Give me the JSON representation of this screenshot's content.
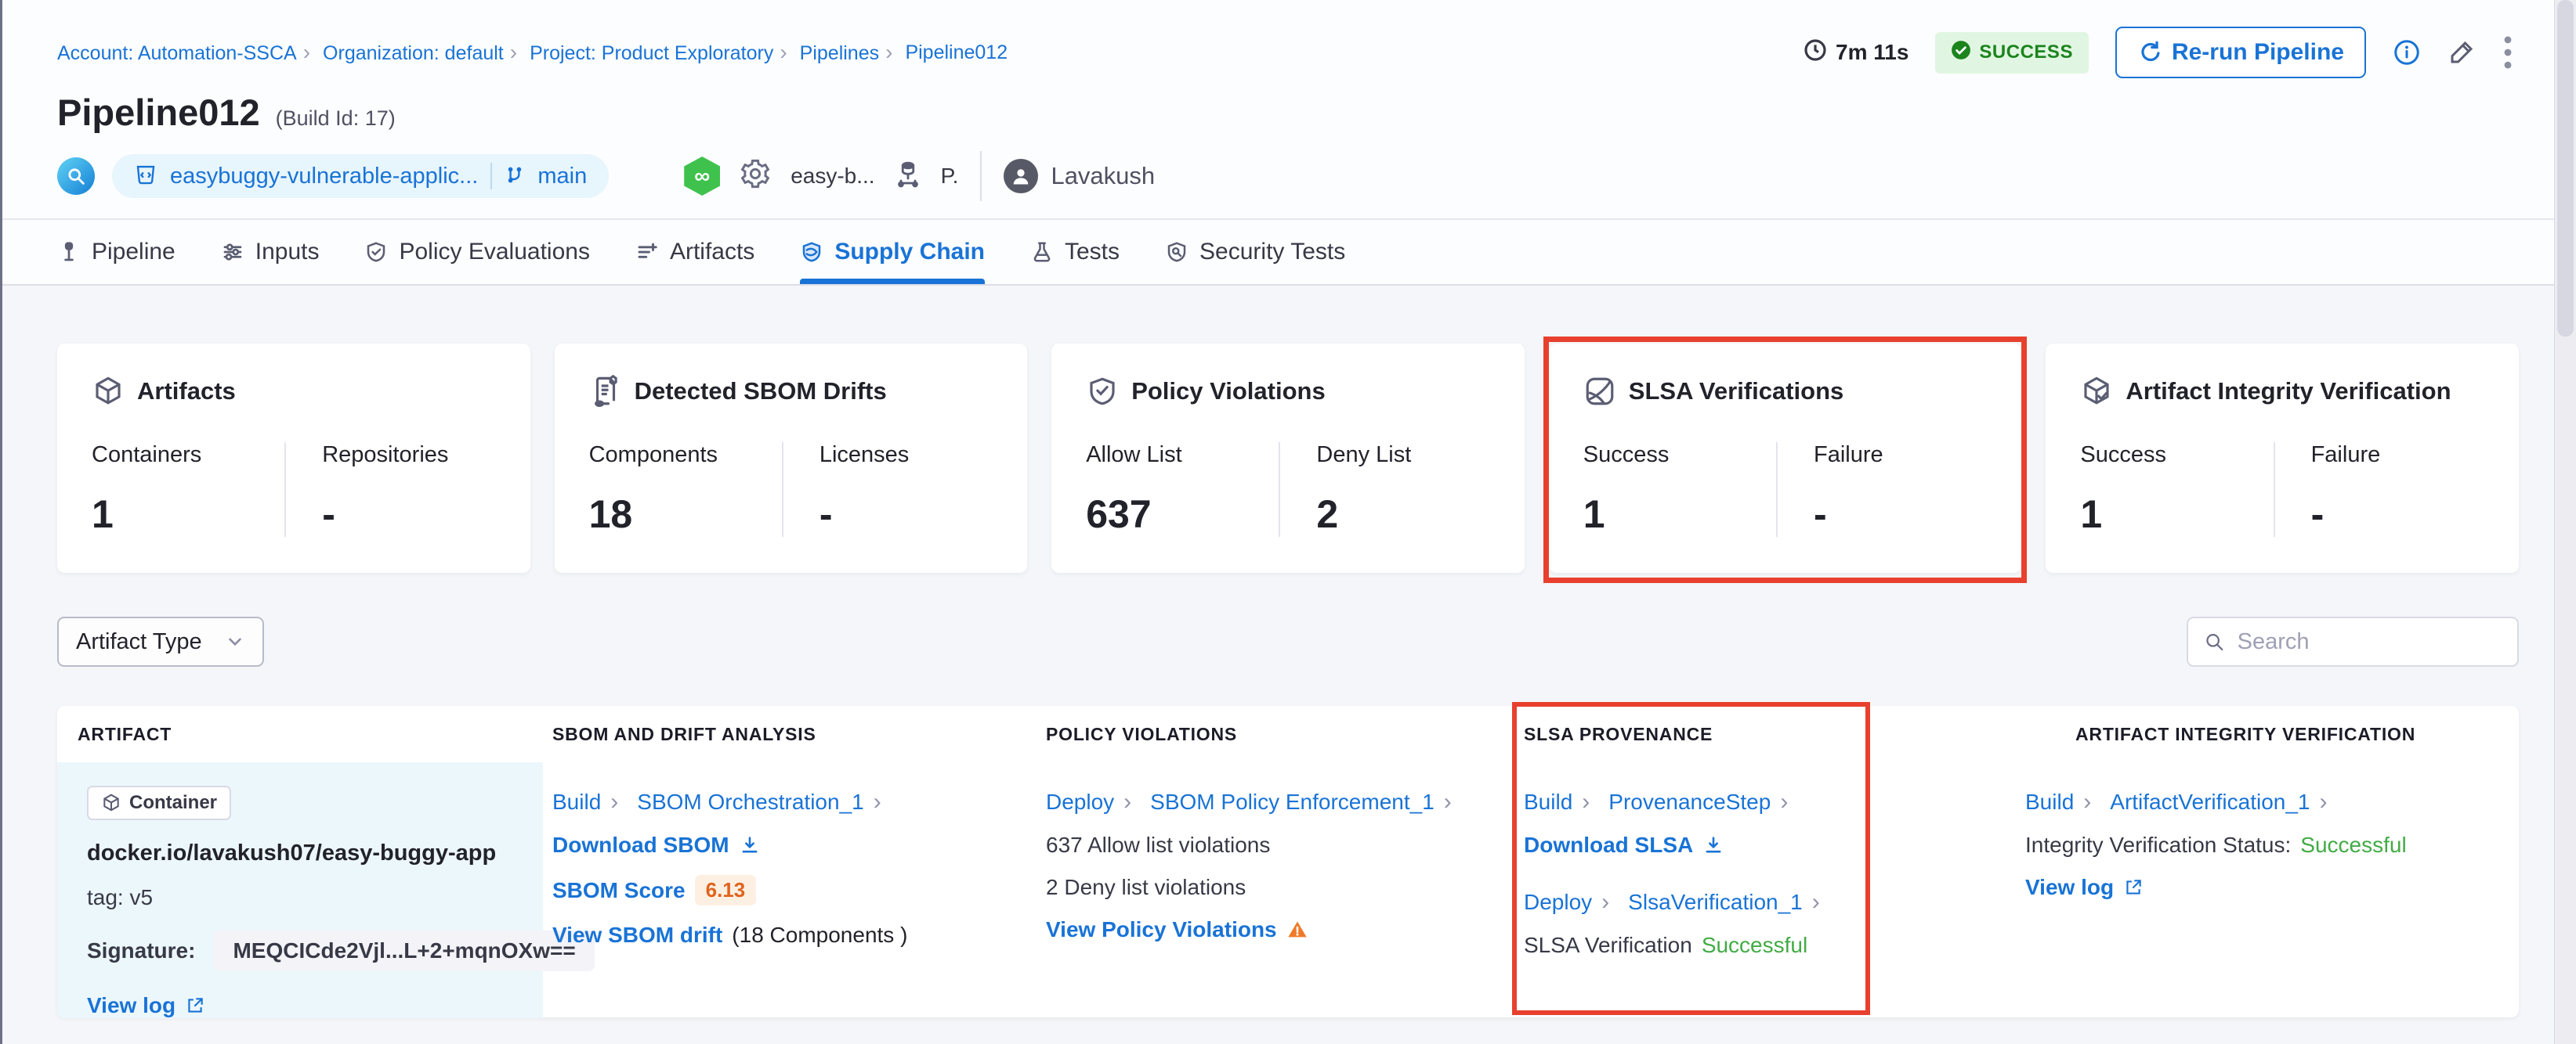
{
  "breadcrumb": {
    "items": [
      "Account: Automation-SSCA",
      "Organization: default",
      "Project: Product Exploratory",
      "Pipelines",
      "Pipeline012"
    ]
  },
  "header": {
    "duration": "7m 11s",
    "status": "SUCCESS",
    "rerun_label": "Re-run Pipeline",
    "title": "Pipeline012",
    "build_id": "(Build Id: 17)",
    "repo_name": "easybuggy-vulnerable-applic...",
    "branch": "main",
    "service": "easy-b...",
    "env": "P.",
    "user": "Lavakush"
  },
  "tabs": [
    {
      "label": "Pipeline"
    },
    {
      "label": "Inputs"
    },
    {
      "label": "Policy Evaluations"
    },
    {
      "label": "Artifacts"
    },
    {
      "label": "Supply Chain"
    },
    {
      "label": "Tests"
    },
    {
      "label": "Security Tests"
    }
  ],
  "cards": [
    {
      "title": "Artifacts",
      "stats": [
        {
          "label": "Containers",
          "value": "1"
        },
        {
          "label": "Repositories",
          "value": "-"
        }
      ]
    },
    {
      "title": "Detected SBOM Drifts",
      "stats": [
        {
          "label": "Components",
          "value": "18"
        },
        {
          "label": "Licenses",
          "value": "-"
        }
      ]
    },
    {
      "title": "Policy Violations",
      "stats": [
        {
          "label": "Allow List",
          "value": "637"
        },
        {
          "label": "Deny List",
          "value": "2"
        }
      ]
    },
    {
      "title": "SLSA Verifications",
      "stats": [
        {
          "label": "Success",
          "value": "1"
        },
        {
          "label": "Failure",
          "value": "-"
        }
      ]
    },
    {
      "title": "Artifact Integrity Verification",
      "stats": [
        {
          "label": "Success",
          "value": "1"
        },
        {
          "label": "Failure",
          "value": "-"
        }
      ]
    }
  ],
  "filters": {
    "artifact_type_label": "Artifact Type",
    "search_placeholder": "Search"
  },
  "table": {
    "headers": [
      "ARTIFACT",
      "SBOM AND DRIFT ANALYSIS",
      "POLICY VIOLATIONS",
      "SLSA PROVENANCE",
      "ARTIFACT INTEGRITY VERIFICATION"
    ],
    "row": {
      "artifact": {
        "type_badge": "Container",
        "name": "docker.io/lavakush07/easy-buggy-app",
        "tag": "tag: v5",
        "signature_label": "Signature:",
        "signature_value": "MEQCICde2Vjl...L+2+mqnOXw==",
        "view_log": "View log"
      },
      "sbom": {
        "stage": "Build",
        "step": "SBOM Orchestration_1",
        "download": "Download SBOM",
        "score_label": "SBOM Score",
        "score": "6.13",
        "drift_link": "View SBOM drift",
        "drift_note": "(18 Components )"
      },
      "policy": {
        "stage": "Deploy",
        "step": "SBOM Policy Enforcement_1",
        "allow": "637 Allow list violations",
        "deny": "2 Deny list violations",
        "link": "View Policy Violations"
      },
      "slsa": {
        "stage1": "Build",
        "step1": "ProvenanceStep",
        "download": "Download SLSA",
        "stage2": "Deploy",
        "step2": "SlsaVerification_1",
        "status_label": "SLSA Verification",
        "status_value": "Successful"
      },
      "integrity": {
        "stage": "Build",
        "step": "ArtifactVerification_1",
        "status_label": "Integrity Verification Status:",
        "status_value": "Successful",
        "view_log": "View log"
      }
    }
  },
  "colors": {
    "accent": "#1973d6",
    "success_green": "#42ab45",
    "highlight_red": "#e8402e",
    "score_orange": "#e0631d"
  }
}
